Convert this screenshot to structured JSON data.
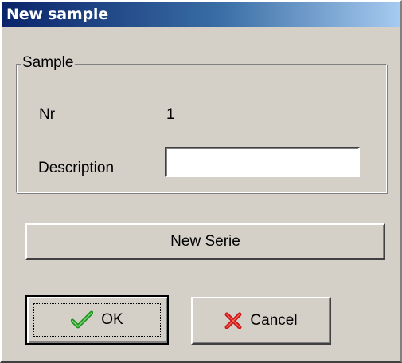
{
  "window": {
    "title": "New sample"
  },
  "group": {
    "legend": "Sample",
    "nr_label": "Nr",
    "nr_value": "1",
    "description_label": "Description",
    "description_value": "",
    "description_placeholder": ""
  },
  "buttons": {
    "new_serie": "New Serie",
    "ok": "OK",
    "cancel": "Cancel"
  },
  "icons": {
    "ok": "checkmark-icon",
    "cancel": "red-x-icon"
  },
  "colors": {
    "title_gradient_start": "#0a246a",
    "title_gradient_end": "#a6caf0",
    "dialog_face": "#d4d0c8",
    "check_green": "#1f9a1f",
    "cancel_red": "#cc1a1a"
  }
}
